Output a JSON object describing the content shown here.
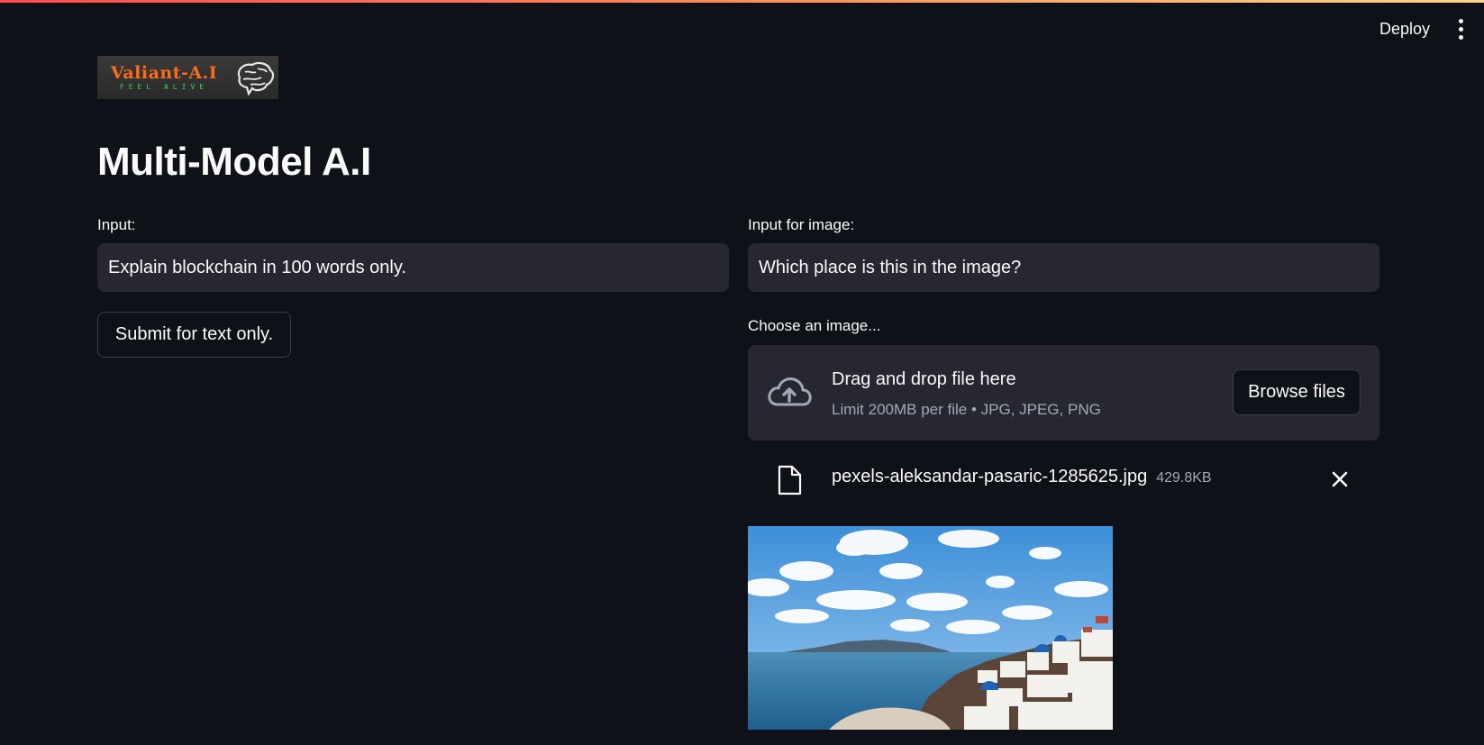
{
  "header": {
    "deploy_label": "Deploy",
    "menu_icon": "vertical-ellipsis-icon",
    "accent_gradient": [
      "#ff4b4b",
      "#ffd38a"
    ]
  },
  "logo": {
    "name": "Valiant-A.I",
    "tagline": "FEEL ALIVE",
    "icon": "brain-icon"
  },
  "main": {
    "title": "Multi-Model A.I",
    "left": {
      "input_label": "Input:",
      "input_value": "Explain blockchain in 100 words only.",
      "submit_label": "Submit for text only."
    },
    "right": {
      "image_input_label": "Input for image:",
      "image_input_value": "Which place is this in the image?",
      "uploader_label": "Choose an image...",
      "dropzone_title": "Drag and drop file here",
      "dropzone_limit": "Limit 200MB per file • JPG, JPEG, PNG",
      "browse_label": "Browse files",
      "uploaded_file": {
        "name": "pexels-aleksandar-pasaric-1285625.jpg",
        "size": "429.8KB"
      }
    }
  },
  "colors": {
    "background": "#0e1117",
    "input_bg": "#262730",
    "text": "#fafafa",
    "muted": "#a3a8b8",
    "logo_orange": "#ff6a1a",
    "logo_green": "#39d353"
  }
}
